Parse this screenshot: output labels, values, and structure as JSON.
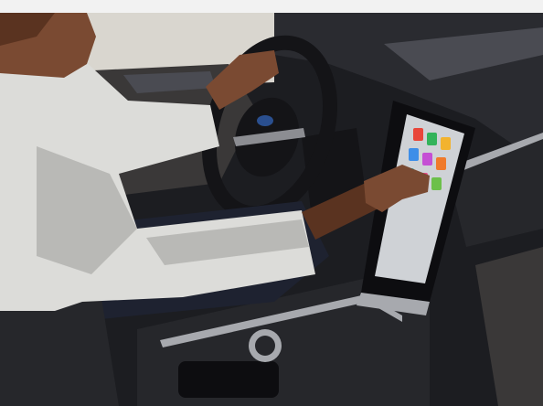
{
  "scene": {
    "colors": {
      "top_border": "#f2f2f2",
      "cabin_dark": "#1c1d21",
      "dashboard": "#2a2b30",
      "dashboard_highlight": "#4a4b52",
      "door_panel": "#3a3838",
      "window_light": "#d9d6cf",
      "sweater": "#dcdcd9",
      "sweater_shadow": "#b9b9b6",
      "skin": "#7a4a32",
      "skin_shadow": "#5a3320",
      "pants": "#1e2230",
      "steering_wheel": "#141417",
      "steering_trim": "#8c8d92",
      "brand_badge": "#2a4f8f",
      "console": "#26272b",
      "console_trim": "#a7a9ae",
      "screen_bezel": "#0d0d10",
      "screen_bg": "#cfd2d6",
      "screen_tiles": [
        "#e8463a",
        "#33b35a",
        "#f2b32e",
        "#3d8ee8",
        "#c54fd4",
        "#f07a2a",
        "#2fc0c8",
        "#e84a8a",
        "#6cc04a"
      ]
    },
    "icons": {
      "brand_logo": "ford-oval-icon"
    }
  }
}
